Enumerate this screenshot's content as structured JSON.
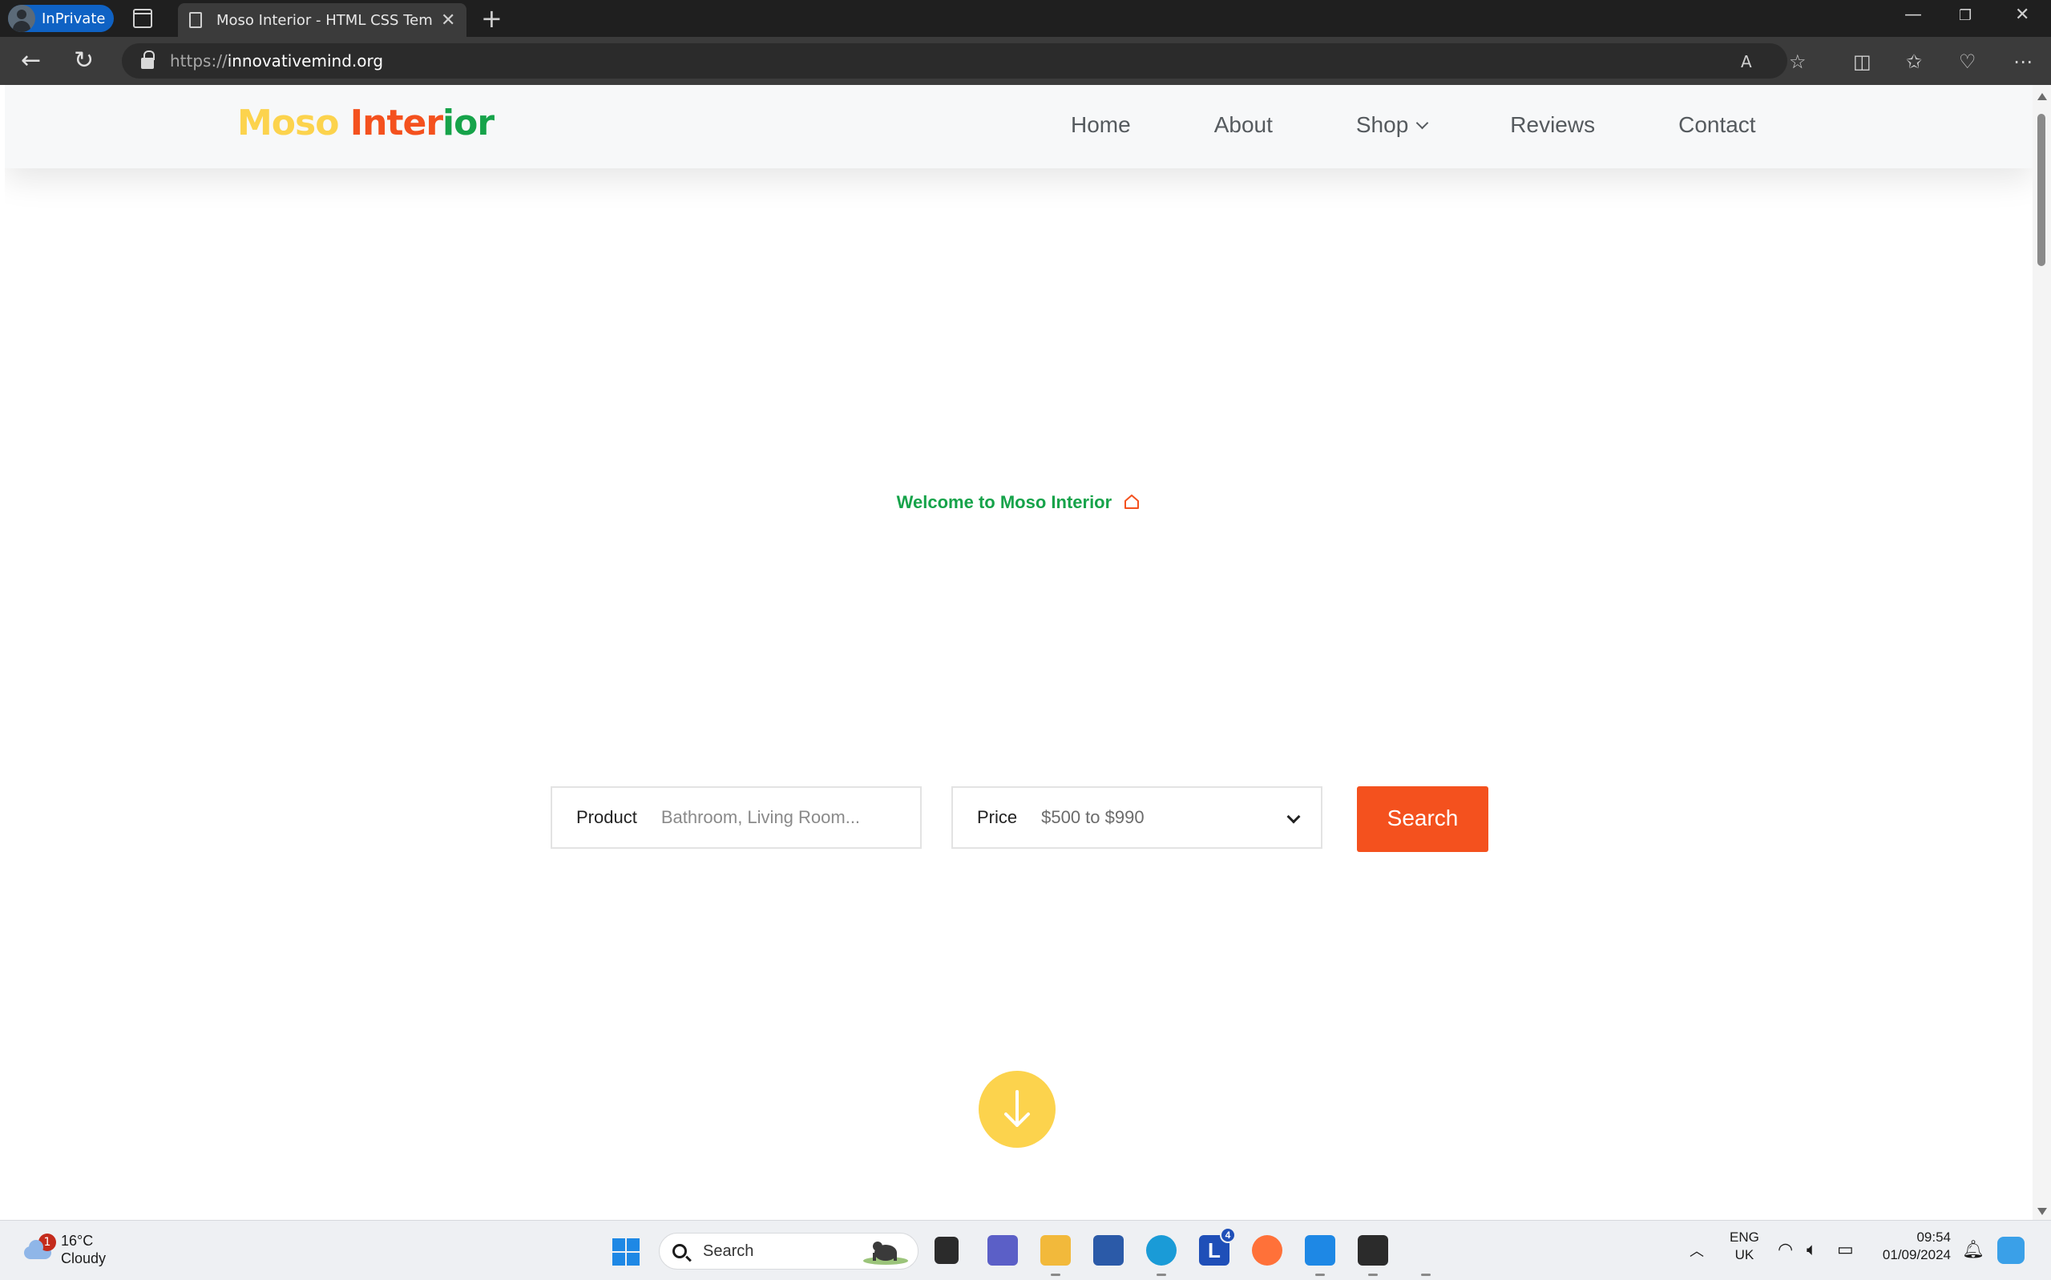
{
  "browser": {
    "profile_label": "InPrivate",
    "tab_title": "Moso Interior - HTML CSS Template",
    "url_scheme": "https://",
    "url_host": "innovativemind.org"
  },
  "site": {
    "logo": {
      "part1": "Moso",
      "part2": "Inter",
      "part3": "ior"
    },
    "nav": [
      "Home",
      "About",
      "Shop",
      "Reviews",
      "Contact"
    ],
    "welcome_text": "Welcome to Moso Interior",
    "search": {
      "product_label": "Product",
      "product_placeholder": "Bathroom, Living Room...",
      "price_label": "Price",
      "price_value": "$500 to $990",
      "button_label": "Search"
    }
  },
  "colors": {
    "logo_yellow": "#fcd34d",
    "accent_red": "#f4511e",
    "brand_green": "#16a34a",
    "down_button": "#fcd34d"
  },
  "taskbar": {
    "weather_badge": "1",
    "weather_temp": "16°C",
    "weather_condition": "Cloudy",
    "search_placeholder": "Search",
    "lang_line1": "ENG",
    "lang_line2": "UK",
    "time": "09:54",
    "date": "01/09/2024",
    "app_badge": "4"
  }
}
